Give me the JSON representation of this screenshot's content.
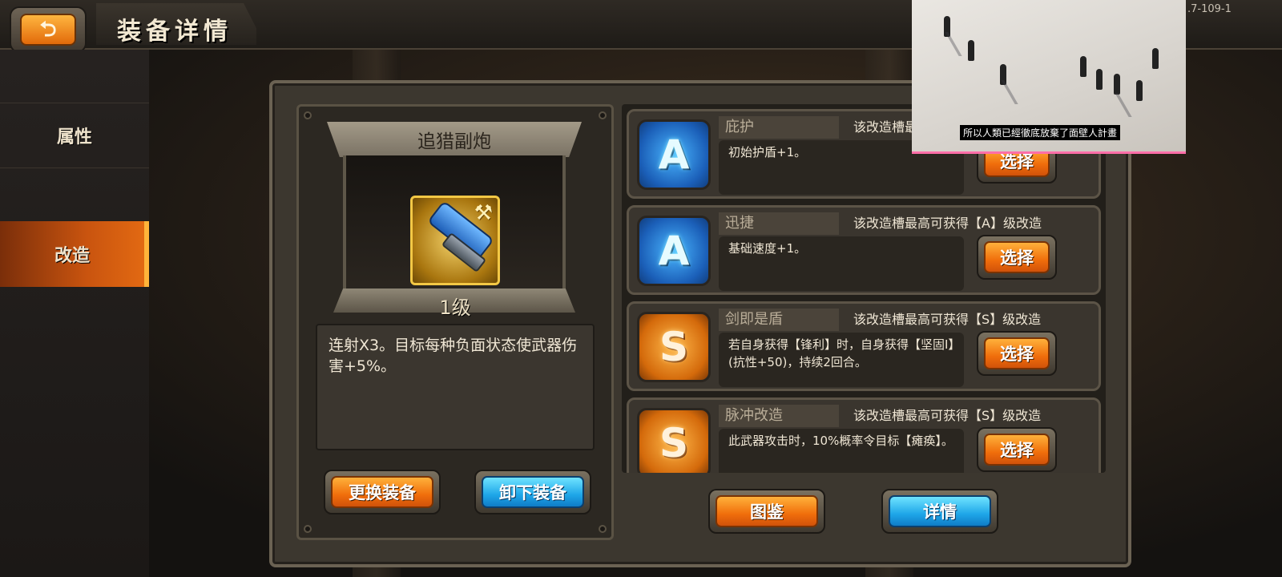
{
  "header": {
    "title": "装备详情",
    "back_icon": "back-arrow-icon",
    "version": ".7-109-1"
  },
  "sidebar": {
    "tabs": [
      {
        "label": "属性",
        "active": false
      },
      {
        "label": "改造",
        "active": true
      }
    ]
  },
  "item": {
    "name": "追猎副炮",
    "level": "1级",
    "description": "连射X3。目标每种负面状态使武器伤害+5%。",
    "icon": "blaster-gun-icon"
  },
  "buttons": {
    "replace": "更换装备",
    "unequip": "卸下装备",
    "codex": "图鉴",
    "details": "详情"
  },
  "mods": [
    {
      "grade": "A",
      "name": "庇护",
      "limit": "该改造槽最高可获得【A】级改造",
      "desc": "初始护盾+1。",
      "select": "选择"
    },
    {
      "grade": "A",
      "name": "迅捷",
      "limit": "该改造槽最高可获得【A】级改造",
      "desc": "基础速度+1。",
      "select": "选择"
    },
    {
      "grade": "S",
      "name": "剑即是盾",
      "limit": "该改造槽最高可获得【S】级改造",
      "desc": "若自身获得【锋利】时，自身获得【坚固Ⅰ】(抗性+50)，持续2回合。",
      "select": "选择"
    },
    {
      "grade": "S",
      "name": "脉冲改造",
      "limit": "该改造槽最高可获得【S】级改造",
      "desc": "此武器攻击时，10%概率令目标【瘫痪】。",
      "select": "选择"
    }
  ],
  "overlay": {
    "caption": "所以人類已經徹底放棄了面壁人計畫"
  },
  "colors": {
    "accent_orange": "#f06e0b",
    "accent_blue": "#1ea6e8",
    "panel": "#3c372f"
  }
}
